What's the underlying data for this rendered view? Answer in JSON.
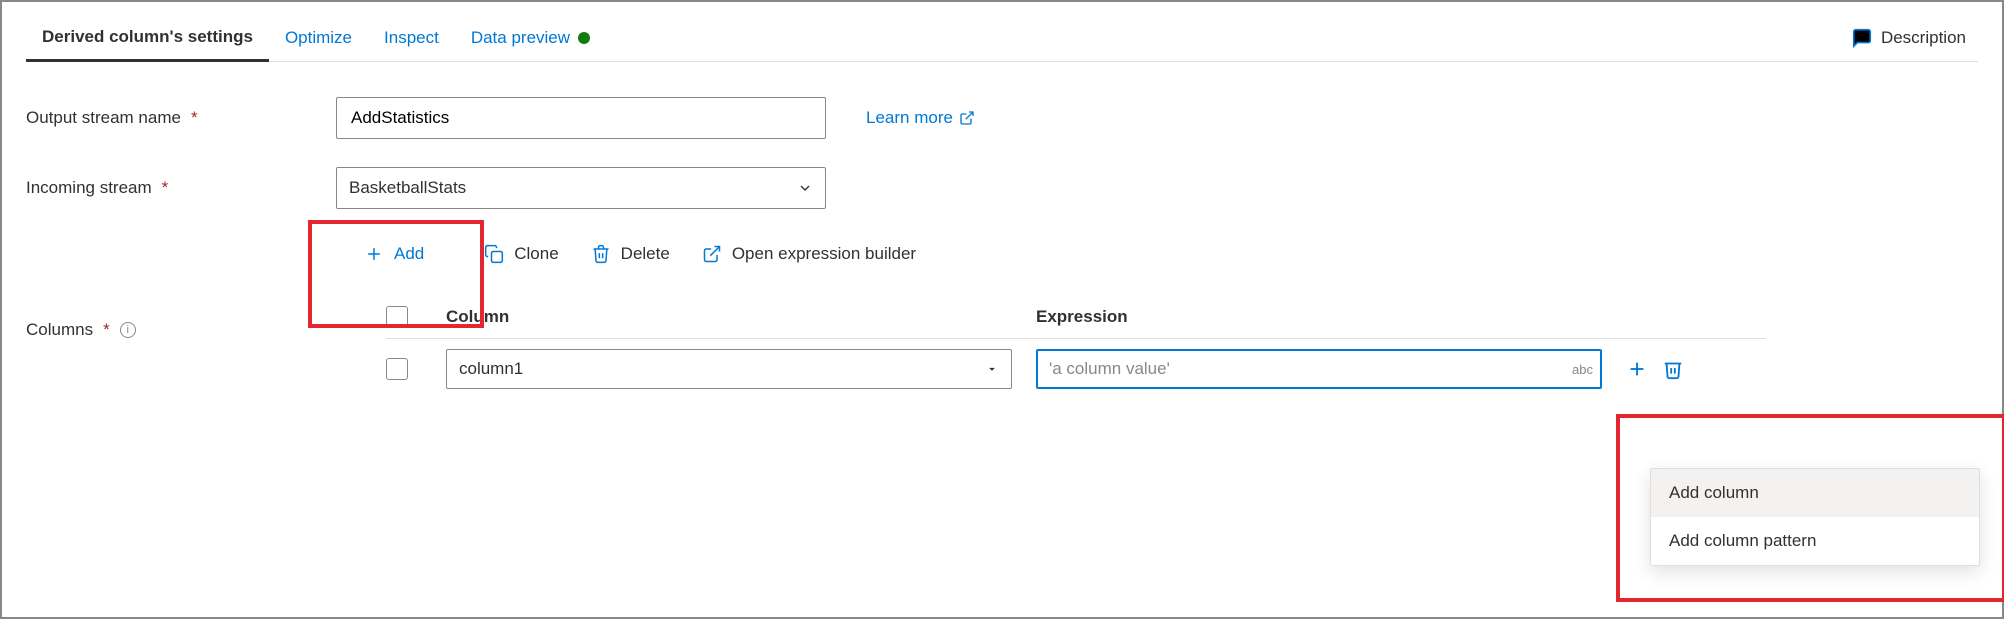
{
  "tabs": {
    "settings": "Derived column's settings",
    "optimize": "Optimize",
    "inspect": "Inspect",
    "preview": "Data preview"
  },
  "description_label": "Description",
  "form": {
    "output_label": "Output stream name",
    "output_value": "AddStatistics",
    "incoming_label": "Incoming stream",
    "incoming_value": "BasketballStats",
    "columns_label": "Columns",
    "learn_more": "Learn more"
  },
  "toolbar": {
    "add": "Add",
    "clone": "Clone",
    "delete": "Delete",
    "builder": "Open expression builder"
  },
  "grid": {
    "col_header": "Column",
    "expr_header": "Expression",
    "row_column_value": "column1",
    "row_expr_placeholder": "'a column value'",
    "type_badge": "abc"
  },
  "menu": {
    "add_column": "Add column",
    "add_pattern": "Add column pattern"
  }
}
